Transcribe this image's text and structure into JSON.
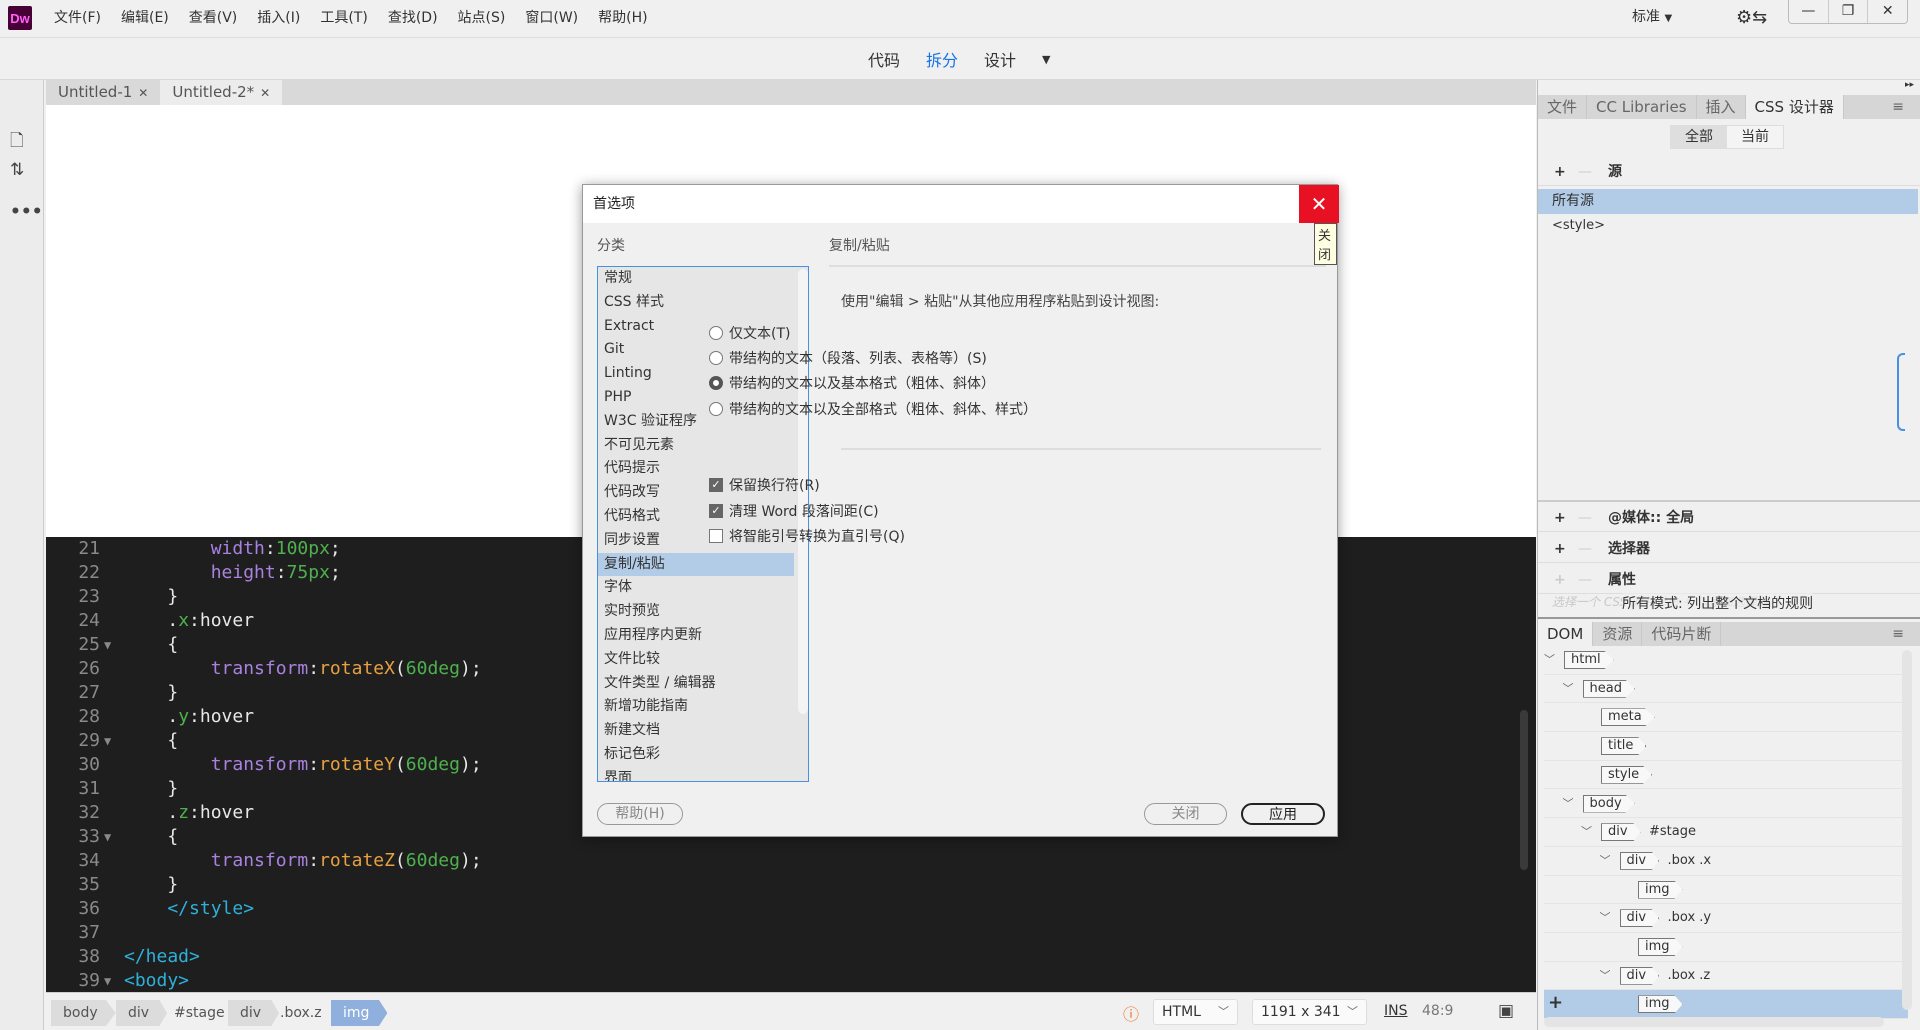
{
  "app": {
    "logo": "Dw",
    "menus": [
      "文件(F)",
      "编辑(E)",
      "查看(V)",
      "插入(I)",
      "工具(T)",
      "查找(D)",
      "站点(S)",
      "窗口(W)",
      "帮助(H)"
    ],
    "workspace": "标准",
    "window_buttons": [
      "—",
      "❐",
      "✕"
    ]
  },
  "view_switch": {
    "items": [
      "代码",
      "拆分",
      "设计"
    ],
    "active": "拆分"
  },
  "doc_tabs": [
    {
      "label": "Untitled-1"
    },
    {
      "label": "Untitled-2*"
    }
  ],
  "code": {
    "lines": [
      {
        "n": "21",
        "fold": false,
        "tokens": [
          [
            "        ",
            "t-plain"
          ],
          [
            "width",
            "t-prop"
          ],
          [
            ":",
            "t-plain"
          ],
          [
            "100px",
            "t-num"
          ],
          [
            ";",
            "t-plain"
          ]
        ]
      },
      {
        "n": "22",
        "fold": false,
        "tokens": [
          [
            "        ",
            "t-plain"
          ],
          [
            "height",
            "t-prop"
          ],
          [
            ":",
            "t-plain"
          ],
          [
            "75px",
            "t-num"
          ],
          [
            ";",
            "t-plain"
          ]
        ]
      },
      {
        "n": "23",
        "fold": false,
        "tokens": [
          [
            "    }",
            "t-plain"
          ]
        ]
      },
      {
        "n": "24",
        "fold": false,
        "tokens": [
          [
            "    .",
            "t-plain"
          ],
          [
            "x",
            "t-cls"
          ],
          [
            ":hover",
            "t-plain"
          ]
        ]
      },
      {
        "n": "25",
        "fold": true,
        "tokens": [
          [
            "    {",
            "t-plain"
          ]
        ]
      },
      {
        "n": "26",
        "fold": false,
        "tokens": [
          [
            "        ",
            "t-plain"
          ],
          [
            "transform",
            "t-prop"
          ],
          [
            ":",
            "t-plain"
          ],
          [
            "rotateX",
            "t-fn"
          ],
          [
            "(",
            "t-plain"
          ],
          [
            "60deg",
            "t-num"
          ],
          [
            ");",
            "t-plain"
          ]
        ]
      },
      {
        "n": "27",
        "fold": false,
        "tokens": [
          [
            "    }",
            "t-plain"
          ]
        ]
      },
      {
        "n": "28",
        "fold": false,
        "tokens": [
          [
            "    .",
            "t-plain"
          ],
          [
            "y",
            "t-cls"
          ],
          [
            ":hover",
            "t-plain"
          ]
        ]
      },
      {
        "n": "29",
        "fold": true,
        "tokens": [
          [
            "    {",
            "t-plain"
          ]
        ]
      },
      {
        "n": "30",
        "fold": false,
        "tokens": [
          [
            "        ",
            "t-plain"
          ],
          [
            "transform",
            "t-prop"
          ],
          [
            ":",
            "t-plain"
          ],
          [
            "rotateY",
            "t-fn"
          ],
          [
            "(",
            "t-plain"
          ],
          [
            "60deg",
            "t-num"
          ],
          [
            ");",
            "t-plain"
          ]
        ]
      },
      {
        "n": "31",
        "fold": false,
        "tokens": [
          [
            "    }",
            "t-plain"
          ]
        ]
      },
      {
        "n": "32",
        "fold": false,
        "tokens": [
          [
            "    .",
            "t-plain"
          ],
          [
            "z",
            "t-cls"
          ],
          [
            ":hover",
            "t-plain"
          ]
        ]
      },
      {
        "n": "33",
        "fold": true,
        "tokens": [
          [
            "    {",
            "t-plain"
          ]
        ]
      },
      {
        "n": "34",
        "fold": false,
        "tokens": [
          [
            "        ",
            "t-plain"
          ],
          [
            "transform",
            "t-prop"
          ],
          [
            ":",
            "t-plain"
          ],
          [
            "rotateZ",
            "t-fn"
          ],
          [
            "(",
            "t-plain"
          ],
          [
            "60deg",
            "t-num"
          ],
          [
            ");",
            "t-plain"
          ]
        ]
      },
      {
        "n": "35",
        "fold": false,
        "tokens": [
          [
            "    }",
            "t-plain"
          ]
        ]
      },
      {
        "n": "36",
        "fold": false,
        "tokens": [
          [
            "    </style>",
            "t-tag"
          ]
        ]
      },
      {
        "n": "37",
        "fold": false,
        "tokens": []
      },
      {
        "n": "38",
        "fold": false,
        "tokens": [
          [
            "</head>",
            "t-tag"
          ]
        ]
      },
      {
        "n": "39",
        "fold": true,
        "tokens": [
          [
            "<body>",
            "t-tag"
          ]
        ]
      }
    ]
  },
  "status": {
    "breadcrumbs": [
      {
        "tag": "body"
      },
      {
        "tag": "div",
        "suffix": "#stage"
      },
      {
        "tag": "div",
        "suffix": ".box.z"
      },
      {
        "tag": "img",
        "selected": true
      }
    ],
    "doc_type": "HTML",
    "size": "1191 x 341",
    "mode": "INS",
    "position": "48:9"
  },
  "css_panel": {
    "tabs": [
      "文件",
      "CC Libraries",
      "插入",
      "CSS 设计器"
    ],
    "active_tab": "CSS 设计器",
    "toggle": [
      "全部",
      "当前"
    ],
    "sources_label": "源",
    "sources": [
      "所有源",
      "<style>"
    ],
    "media_label": "@媒体:: 全局",
    "selectors_label": "选择器",
    "properties_label": "属性",
    "hint_faded": "选择一个 CSS 源并单击 + 以添加选择器。",
    "hint": "所有模式: 列出整个文档的规则"
  },
  "dom_panel": {
    "tabs": [
      "DOM",
      "资源",
      "代码片断"
    ],
    "nodes": [
      {
        "tag": "html",
        "depth": 0,
        "expand": true
      },
      {
        "tag": "head",
        "depth": 1,
        "expand": true
      },
      {
        "tag": "meta",
        "depth": 2
      },
      {
        "tag": "title",
        "depth": 2
      },
      {
        "tag": "style",
        "depth": 2
      },
      {
        "tag": "body",
        "depth": 1,
        "expand": true
      },
      {
        "tag": "div",
        "after": "#stage",
        "depth": 2,
        "expand": true
      },
      {
        "tag": "div",
        "after": ".box .x",
        "depth": 3,
        "expand": true
      },
      {
        "tag": "img",
        "depth": 4
      },
      {
        "tag": "div",
        "after": ".box .y",
        "depth": 3,
        "expand": true
      },
      {
        "tag": "img",
        "depth": 4
      },
      {
        "tag": "div",
        "after": ".box .z",
        "depth": 3,
        "expand": true
      },
      {
        "tag": "img",
        "depth": 4,
        "selected": true
      }
    ]
  },
  "dialog": {
    "title": "首选项",
    "close_tooltip": "关闭",
    "category_label": "分类",
    "categories": [
      "常规",
      "CSS 样式",
      "Extract",
      "Git",
      "Linting",
      "PHP",
      "W3C 验证程序",
      "不可见元素",
      "代码提示",
      "代码改写",
      "代码格式",
      "同步设置",
      "复制/粘贴",
      "字体",
      "实时预览",
      "应用程序内更新",
      "文件比较",
      "文件类型 / 编辑器",
      "新增功能指南",
      "新建文档",
      "标记色彩",
      "界面"
    ],
    "selected_category": "复制/粘贴",
    "section_title": "复制/粘贴",
    "paste_prompt": "使用\"编辑 > 粘贴\"从其他应用程序粘贴到设计视图:",
    "radios": [
      {
        "label": "仅文本(T)",
        "checked": false
      },
      {
        "label": "带结构的文本（段落、列表、表格等）(S)",
        "checked": false
      },
      {
        "label": "带结构的文本以及基本格式（粗体、斜体）",
        "checked": true
      },
      {
        "label": "带结构的文本以及全部格式（粗体、斜体、样式）",
        "checked": false
      }
    ],
    "checkboxes": [
      {
        "label": "保留换行符(R)",
        "checked": true
      },
      {
        "label": "清理 Word 段落间距(C)",
        "checked": true
      },
      {
        "label": "将智能引号转换为直引号(Q)",
        "checked": false
      }
    ],
    "help_button": "帮助(H)",
    "close_button": "关闭",
    "apply_button": "应用"
  }
}
